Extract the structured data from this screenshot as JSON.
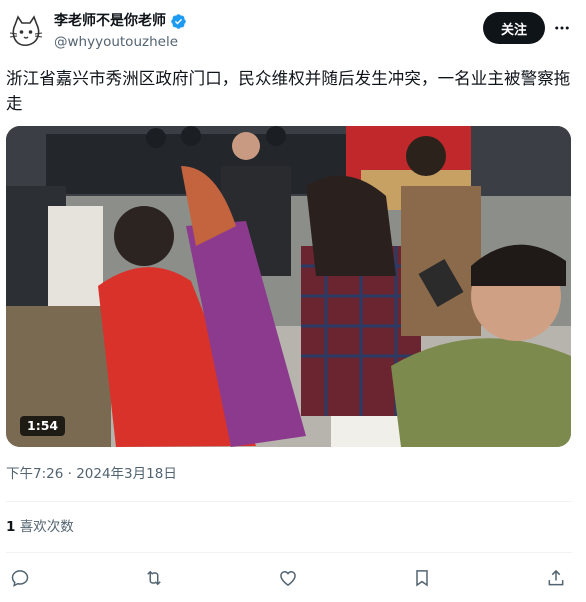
{
  "author": {
    "display_name": "李老师不是你老师",
    "handle": "@whyyoutouzhele",
    "verified": true,
    "verified_color": "#1d9bf0"
  },
  "follow_label": "关注",
  "tweet": {
    "text": "浙江省嘉兴市秀洲区政府门口，民众维权并随后发生冲突，一名业主被警察拖走"
  },
  "media": {
    "type": "video",
    "duration": "1:54"
  },
  "timestamp": "下午7:26 · 2024年3月18日",
  "stats": {
    "likes_count": "1",
    "likes_label": "喜欢次数"
  },
  "actions": [
    "reply-icon",
    "retweet-icon",
    "like-icon",
    "bookmark-icon",
    "share-icon"
  ],
  "colors": {
    "text_primary": "#0f1419",
    "text_secondary": "#536471",
    "divider": "#eff3f4",
    "follow_bg": "#0f1419"
  }
}
